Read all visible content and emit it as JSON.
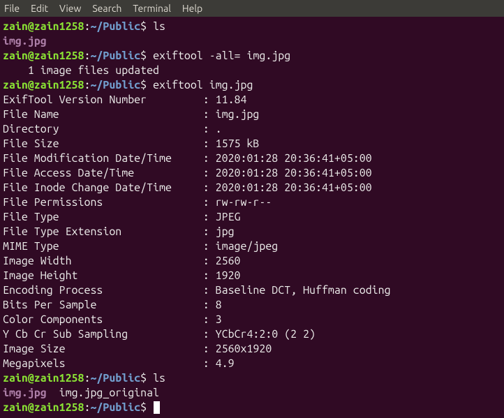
{
  "menubar": [
    "File",
    "Edit",
    "View",
    "Search",
    "Terminal",
    "Help"
  ],
  "prompt": {
    "user_host": "zain@zain1258",
    "sep": ":",
    "path": "~/Public",
    "end": "$ "
  },
  "cmds": {
    "ls1": "ls",
    "exif_strip": "exiftool -all= img.jpg",
    "exif_show": "exiftool img.jpg",
    "ls2": "ls"
  },
  "outputs": {
    "ls1": "img.jpg",
    "strip_result": "    1 image files updated",
    "ls2a": "img.jpg",
    "ls2b": "  img.jpg_original"
  },
  "exif": [
    {
      "k": "ExifTool Version Number",
      "v": "11.84"
    },
    {
      "k": "File Name",
      "v": "img.jpg"
    },
    {
      "k": "Directory",
      "v": "."
    },
    {
      "k": "File Size",
      "v": "1575 kB"
    },
    {
      "k": "File Modification Date/Time",
      "v": "2020:01:28 20:36:41+05:00"
    },
    {
      "k": "File Access Date/Time",
      "v": "2020:01:28 20:36:41+05:00"
    },
    {
      "k": "File Inode Change Date/Time",
      "v": "2020:01:28 20:36:41+05:00"
    },
    {
      "k": "File Permissions",
      "v": "rw-rw-r--"
    },
    {
      "k": "File Type",
      "v": "JPEG"
    },
    {
      "k": "File Type Extension",
      "v": "jpg"
    },
    {
      "k": "MIME Type",
      "v": "image/jpeg"
    },
    {
      "k": "Image Width",
      "v": "2560"
    },
    {
      "k": "Image Height",
      "v": "1920"
    },
    {
      "k": "Encoding Process",
      "v": "Baseline DCT, Huffman coding"
    },
    {
      "k": "Bits Per Sample",
      "v": "8"
    },
    {
      "k": "Color Components",
      "v": "3"
    },
    {
      "k": "Y Cb Cr Sub Sampling",
      "v": "YCbCr4:2:0 (2 2)"
    },
    {
      "k": "Image Size",
      "v": "2560x1920"
    },
    {
      "k": "Megapixels",
      "v": "4.9"
    }
  ]
}
